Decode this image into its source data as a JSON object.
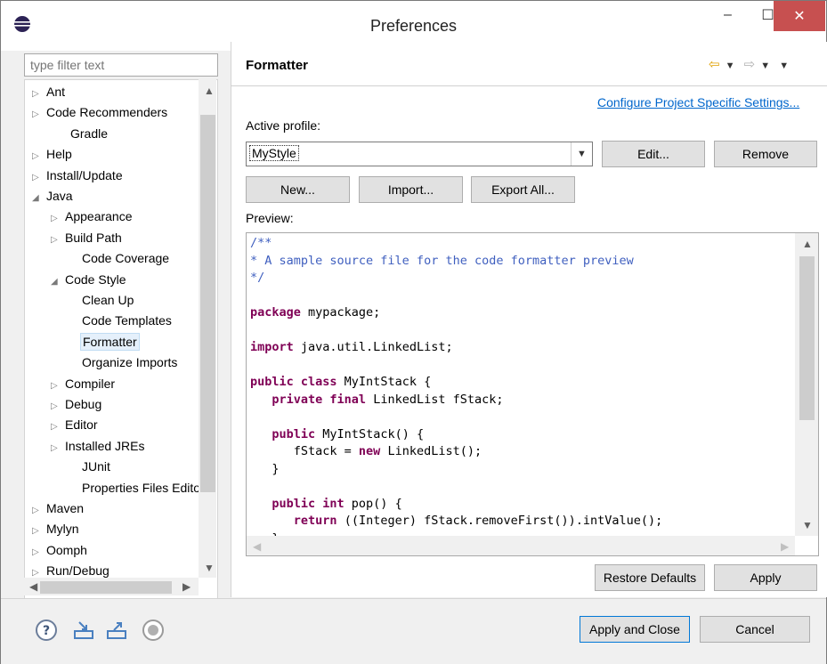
{
  "window": {
    "title": "Preferences",
    "minimize_glyph": "–",
    "maximize_glyph": "☐",
    "close_glyph": "✕"
  },
  "filter": {
    "placeholder": "type filter text"
  },
  "tree": {
    "items": [
      {
        "label": "Ant",
        "twisty": "▷"
      },
      {
        "label": "Code Recommenders",
        "twisty": "▷"
      },
      {
        "label": "Gradle",
        "twisty": ""
      },
      {
        "label": "Help",
        "twisty": "▷"
      },
      {
        "label": "Install/Update",
        "twisty": "▷"
      },
      {
        "label": "Java",
        "twisty": "◢"
      },
      {
        "label": "Appearance",
        "twisty": "▷"
      },
      {
        "label": "Build Path",
        "twisty": "▷"
      },
      {
        "label": "Code Coverage",
        "twisty": ""
      },
      {
        "label": "Code Style",
        "twisty": "◢"
      },
      {
        "label": "Clean Up",
        "twisty": ""
      },
      {
        "label": "Code Templates",
        "twisty": ""
      },
      {
        "label": "Formatter",
        "twisty": "",
        "selected": true
      },
      {
        "label": "Organize Imports",
        "twisty": ""
      },
      {
        "label": "Compiler",
        "twisty": "▷"
      },
      {
        "label": "Debug",
        "twisty": "▷"
      },
      {
        "label": "Editor",
        "twisty": "▷"
      },
      {
        "label": "Installed JREs",
        "twisty": "▷"
      },
      {
        "label": "JUnit",
        "twisty": ""
      },
      {
        "label": "Properties Files Editor",
        "twisty": ""
      },
      {
        "label": "Maven",
        "twisty": "▷"
      },
      {
        "label": "Mylyn",
        "twisty": "▷"
      },
      {
        "label": "Oomph",
        "twisty": "▷"
      },
      {
        "label": "Run/Debug",
        "twisty": "▷"
      }
    ]
  },
  "page": {
    "title": "Formatter",
    "configure_link": "Configure Project Specific Settings...",
    "active_profile_label": "Active profile:",
    "profile_value": "MyStyle",
    "edit_button": "Edit...",
    "remove_button": "Remove",
    "new_button": "New...",
    "import_button": "Import...",
    "export_all_button": "Export All...",
    "preview_label": "Preview:",
    "restore_defaults_button": "Restore Defaults",
    "apply_button": "Apply"
  },
  "preview": {
    "lines": [
      [
        {
          "t": "/**",
          "c": "comment"
        }
      ],
      [
        {
          "t": "* A sample source file for the code formatter preview",
          "c": "comment"
        }
      ],
      [
        {
          "t": "*/",
          "c": "comment"
        }
      ],
      [],
      [
        {
          "t": "package",
          "c": "kw"
        },
        {
          "t": " mypackage;",
          "c": ""
        }
      ],
      [],
      [
        {
          "t": "import",
          "c": "kw"
        },
        {
          "t": " java.util.LinkedList;",
          "c": ""
        }
      ],
      [],
      [
        {
          "t": "public class",
          "c": "kw"
        },
        {
          "t": " MyIntStack {",
          "c": ""
        }
      ],
      [
        {
          "t": "   ",
          "c": ""
        },
        {
          "t": "private final",
          "c": "kw"
        },
        {
          "t": " LinkedList fStack;",
          "c": ""
        }
      ],
      [],
      [
        {
          "t": "   ",
          "c": ""
        },
        {
          "t": "public",
          "c": "kw"
        },
        {
          "t": " MyIntStack() {",
          "c": ""
        }
      ],
      [
        {
          "t": "      fStack = ",
          "c": ""
        },
        {
          "t": "new",
          "c": "kw"
        },
        {
          "t": " LinkedList();",
          "c": ""
        }
      ],
      [
        {
          "t": "   }",
          "c": ""
        }
      ],
      [],
      [
        {
          "t": "   ",
          "c": ""
        },
        {
          "t": "public int",
          "c": "kw"
        },
        {
          "t": " pop() {",
          "c": ""
        }
      ],
      [
        {
          "t": "      ",
          "c": ""
        },
        {
          "t": "return",
          "c": "kw"
        },
        {
          "t": " ((Integer) fStack.removeFirst()).intValue();",
          "c": ""
        }
      ],
      [
        {
          "t": "   }",
          "c": ""
        }
      ]
    ]
  },
  "footer": {
    "apply_and_close_button": "Apply and Close",
    "cancel_button": "Cancel"
  }
}
